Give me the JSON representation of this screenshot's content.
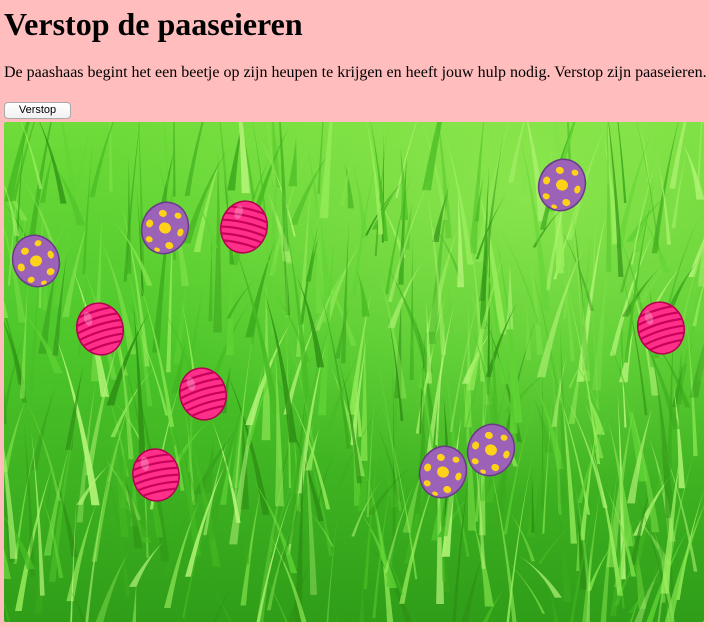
{
  "page": {
    "title": "Verstop de paaseieren",
    "intro": "De paashaas begint het een beetje op zijn heupen te krijgen en heeft jouw hulp nodig. Verstop zijn paaseieren.",
    "hide_button_label": "Verstop"
  },
  "colors": {
    "background": "#ffbdbd",
    "grass": "#4fc72a",
    "egg_purple": "#9b62b8",
    "egg_dots": "#ffd21a",
    "egg_pink": "#ff2f8a",
    "egg_stripes": "#c8005a"
  },
  "eggs": [
    {
      "style": "purple-dots"
    },
    {
      "style": "purple-dots"
    },
    {
      "style": "pink-stripes"
    },
    {
      "style": "purple-dots"
    },
    {
      "style": "pink-stripes"
    },
    {
      "style": "pink-stripes"
    },
    {
      "style": "pink-stripes"
    },
    {
      "style": "pink-stripes"
    },
    {
      "style": "purple-dots"
    },
    {
      "style": "purple-dots"
    }
  ]
}
